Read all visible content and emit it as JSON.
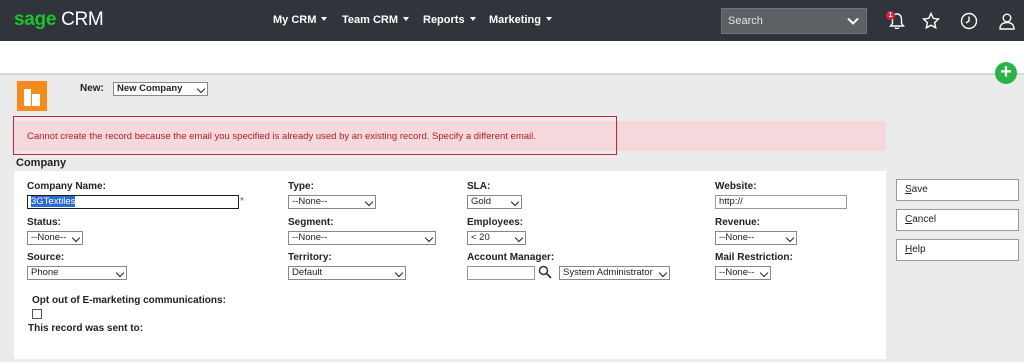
{
  "brand": {
    "sage": "sage",
    "crm": "CRM",
    "accent": "#1dc12d"
  },
  "nav": {
    "items": [
      {
        "label": "My CRM"
      },
      {
        "label": "Team CRM"
      },
      {
        "label": "Reports"
      },
      {
        "label": "Marketing"
      }
    ],
    "search_placeholder": "Search",
    "notification_count": "1",
    "icons": [
      "bell-icon",
      "star-icon",
      "clock-icon",
      "user-icon"
    ]
  },
  "toolbar": {
    "new_label": "New:",
    "new_value": "New Company",
    "add_symbol": "+"
  },
  "error": {
    "message": "Cannot create the record because the email you specified is already used by an existing record. Specify a different email.",
    "color": "#b0202a"
  },
  "section": {
    "title": "Company"
  },
  "form": {
    "company_name": {
      "label": "Company Name:",
      "value": "3GTextiles",
      "required_mark": "*"
    },
    "type": {
      "label": "Type:",
      "value": "--None--"
    },
    "sla": {
      "label": "SLA:",
      "value": "Gold"
    },
    "website": {
      "label": "Website:",
      "value": "http://"
    },
    "status": {
      "label": "Status:",
      "value": "--None--"
    },
    "segment": {
      "label": "Segment:",
      "value": "--None--"
    },
    "employees": {
      "label": "Employees:",
      "value": "< 20"
    },
    "revenue": {
      "label": "Revenue:",
      "value": "--None--"
    },
    "source": {
      "label": "Source:",
      "value": "Phone"
    },
    "territory": {
      "label": "Territory:",
      "value": "Default"
    },
    "account_manager": {
      "label": "Account Manager:",
      "value": "",
      "selected": "System Administrator"
    },
    "mail_restriction": {
      "label": "Mail Restriction:",
      "value": "--None--"
    },
    "opt_out": {
      "label": "Opt out of E-marketing communications:",
      "checked": false
    },
    "sent_to": {
      "label": "This record was sent to:"
    }
  },
  "actions": {
    "save": {
      "first": "S",
      "rest": "ave"
    },
    "cancel": {
      "first": "C",
      "rest": "ancel"
    },
    "help": {
      "first": "H",
      "rest": "elp"
    }
  }
}
